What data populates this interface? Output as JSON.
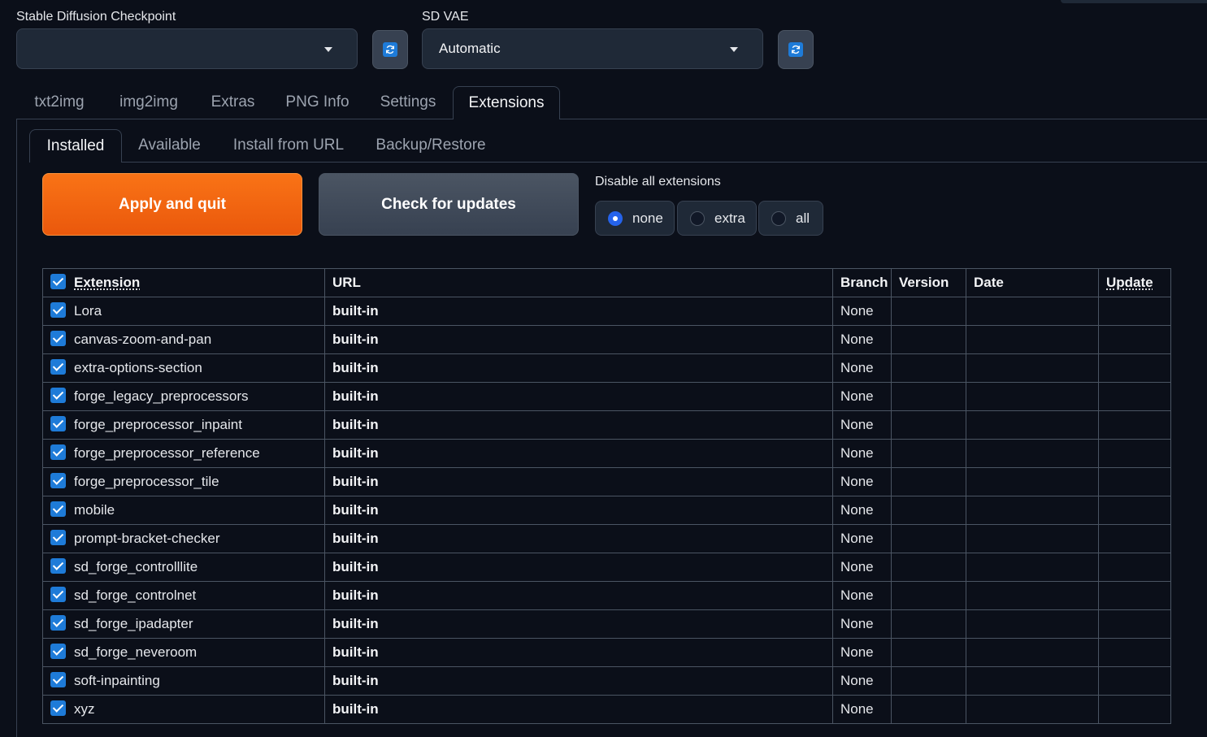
{
  "checkpoint": {
    "label": "Stable Diffusion Checkpoint",
    "value": ""
  },
  "vae": {
    "label": "SD VAE",
    "value": "Automatic"
  },
  "main_tabs": [
    "txt2img",
    "img2img",
    "Extras",
    "PNG Info",
    "Settings",
    "Extensions"
  ],
  "main_tab_active": "Extensions",
  "sub_tabs": [
    "Installed",
    "Available",
    "Install from URL",
    "Backup/Restore"
  ],
  "sub_tab_active": "Installed",
  "apply_button": "Apply and quit",
  "check_button": "Check for updates",
  "disable": {
    "label": "Disable all extensions",
    "options": [
      "none",
      "extra",
      "all"
    ],
    "selected": "none"
  },
  "table": {
    "headers": [
      "Extension",
      "URL",
      "Branch",
      "Version",
      "Date",
      "Update"
    ],
    "rows": [
      {
        "name": "Lora",
        "url": "built-in",
        "branch": "None",
        "version": "",
        "date": "",
        "update": ""
      },
      {
        "name": "canvas-zoom-and-pan",
        "url": "built-in",
        "branch": "None",
        "version": "",
        "date": "",
        "update": ""
      },
      {
        "name": "extra-options-section",
        "url": "built-in",
        "branch": "None",
        "version": "",
        "date": "",
        "update": ""
      },
      {
        "name": "forge_legacy_preprocessors",
        "url": "built-in",
        "branch": "None",
        "version": "",
        "date": "",
        "update": ""
      },
      {
        "name": "forge_preprocessor_inpaint",
        "url": "built-in",
        "branch": "None",
        "version": "",
        "date": "",
        "update": ""
      },
      {
        "name": "forge_preprocessor_reference",
        "url": "built-in",
        "branch": "None",
        "version": "",
        "date": "",
        "update": ""
      },
      {
        "name": "forge_preprocessor_tile",
        "url": "built-in",
        "branch": "None",
        "version": "",
        "date": "",
        "update": ""
      },
      {
        "name": "mobile",
        "url": "built-in",
        "branch": "None",
        "version": "",
        "date": "",
        "update": ""
      },
      {
        "name": "prompt-bracket-checker",
        "url": "built-in",
        "branch": "None",
        "version": "",
        "date": "",
        "update": ""
      },
      {
        "name": "sd_forge_controlllite",
        "url": "built-in",
        "branch": "None",
        "version": "",
        "date": "",
        "update": ""
      },
      {
        "name": "sd_forge_controlnet",
        "url": "built-in",
        "branch": "None",
        "version": "",
        "date": "",
        "update": ""
      },
      {
        "name": "sd_forge_ipadapter",
        "url": "built-in",
        "branch": "None",
        "version": "",
        "date": "",
        "update": ""
      },
      {
        "name": "sd_forge_neveroom",
        "url": "built-in",
        "branch": "None",
        "version": "",
        "date": "",
        "update": ""
      },
      {
        "name": "soft-inpainting",
        "url": "built-in",
        "branch": "None",
        "version": "",
        "date": "",
        "update": ""
      },
      {
        "name": "xyz",
        "url": "built-in",
        "branch": "None",
        "version": "",
        "date": "",
        "update": ""
      }
    ]
  },
  "colors": {
    "background": "#0b0f19",
    "accent_orange": "#f97316",
    "checkbox_blue": "#1e7bd8"
  }
}
